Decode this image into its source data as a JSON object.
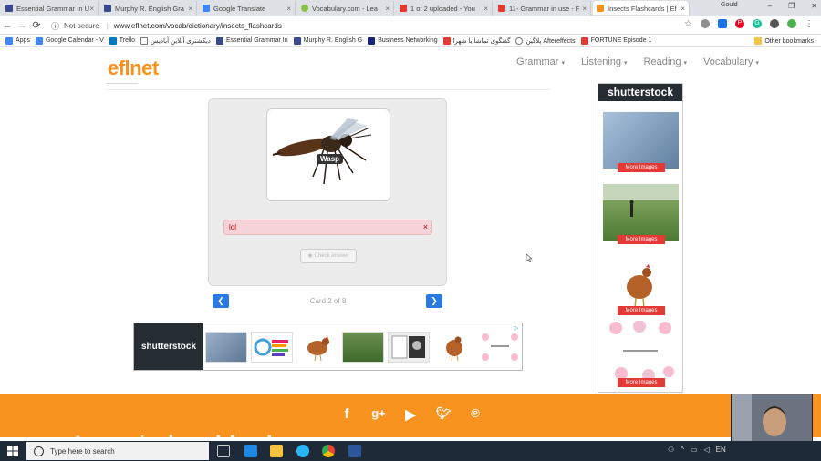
{
  "browser": {
    "tabs": [
      {
        "title": "Essential Grammar In U",
        "color": "#3a4a8a"
      },
      {
        "title": "Murphy R. English Gra",
        "color": "#3a4a8a"
      },
      {
        "title": "Google Translate",
        "color": "#4285f4"
      },
      {
        "title": "Vocabulary.com - Lea",
        "color": "#8bc34a"
      },
      {
        "title": "1 of 2 uploaded - You",
        "color": "#e53935"
      },
      {
        "title": "11- Grammar in use - F",
        "color": "#e53935"
      },
      {
        "title": "Insects Flashcards | Ef",
        "color": "#f7931e"
      }
    ],
    "user_name": "Gould",
    "nav": {
      "back": "←",
      "forward": "→",
      "reload": "⟳"
    },
    "not_secure": "Not secure",
    "url": "www.eflnet.com/vocab/dictionary/insects_flashcards",
    "bookmarks": [
      {
        "label": "Apps",
        "color": "#4285f4"
      },
      {
        "label": "Google Calendar - V",
        "color": "#4285f4"
      },
      {
        "label": "Trello",
        "color": "#0079bf"
      },
      {
        "label": "دیکشنری آنلاین آبادیس",
        "color": "#777"
      },
      {
        "label": "Essential Grammar In",
        "color": "#3a4a8a"
      },
      {
        "label": "Murphy R. English G",
        "color": "#3a4a8a"
      },
      {
        "label": "Business Networking",
        "color": "#1a237e"
      },
      {
        "label": "گفتگوی تماشا با شهرا",
        "color": "#e53935"
      },
      {
        "label": "پلاگین Aftereffects",
        "color": "#777"
      },
      {
        "label": "FORTUNE Episode 1",
        "color": "#e53935"
      }
    ],
    "other_bookmarks": "Other bookmarks"
  },
  "site": {
    "logo": "eflnet",
    "nav": [
      "Grammar",
      "Listening",
      "Reading",
      "Vocabulary"
    ],
    "caret": "▾"
  },
  "flashcard": {
    "word_label": "Wasp",
    "answer_value": "lol",
    "clear_icon": "×",
    "check_label": "Check answer",
    "counter": "Card 2 of 8",
    "prev_icon": "chevron-left-icon",
    "next_icon": "chevron-right-icon"
  },
  "ad_banner": {
    "brand": "shutterstock"
  },
  "sidebar_ad": {
    "brand": "shutterstock",
    "more_label": "More Images"
  },
  "footer": {
    "social_icons": [
      "facebook-icon",
      "google-plus-icon",
      "youtube-icon",
      "twitter-icon",
      "pinterest-icon"
    ]
  },
  "watermark": "aparat.com/arianabhari",
  "taskbar": {
    "search_placeholder": "Type here to search"
  }
}
